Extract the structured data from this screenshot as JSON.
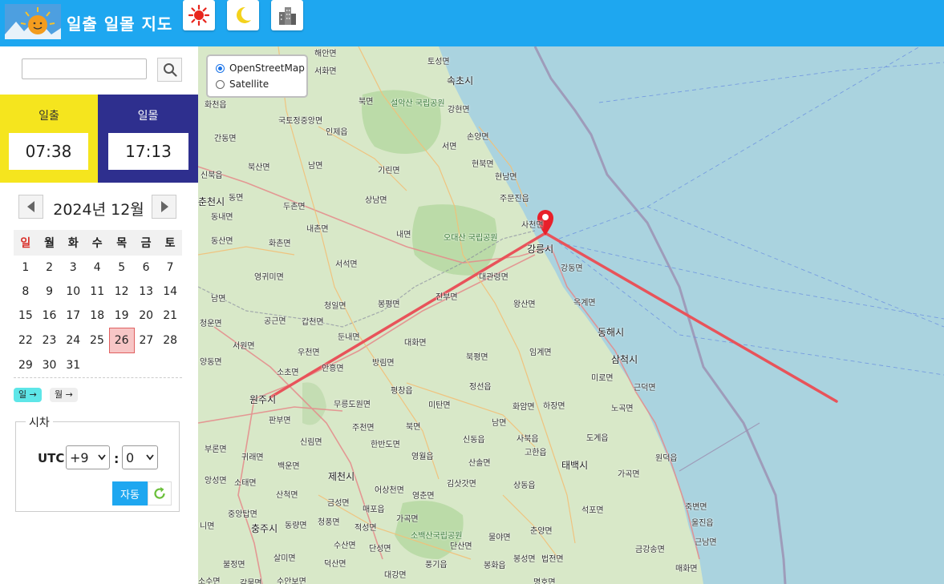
{
  "header": {
    "title": "일출 일몰 지도",
    "buttons": [
      {
        "name": "sun-mode-button",
        "icon": "sun-icon"
      },
      {
        "name": "moon-mode-button",
        "icon": "moon-icon"
      },
      {
        "name": "building-mode-button",
        "icon": "building-icon"
      }
    ]
  },
  "search": {
    "value": "",
    "placeholder": ""
  },
  "sunrise": {
    "label": "일출",
    "time": "07:38"
  },
  "sunset": {
    "label": "일몰",
    "time": "17:13"
  },
  "calendar": {
    "month_label": "2024년 12월",
    "weekdays": [
      "일",
      "월",
      "화",
      "수",
      "목",
      "금",
      "토"
    ],
    "weeks": [
      [
        "1",
        "2",
        "3",
        "4",
        "5",
        "6",
        "7"
      ],
      [
        "8",
        "9",
        "10",
        "11",
        "12",
        "13",
        "14"
      ],
      [
        "15",
        "16",
        "17",
        "18",
        "19",
        "20",
        "21"
      ],
      [
        "22",
        "23",
        "24",
        "25",
        "26",
        "27",
        "28"
      ],
      [
        "29",
        "30",
        "31",
        "",
        "",
        "",
        ""
      ]
    ],
    "selected_day": "26",
    "next_day_label": "일 →",
    "next_month_label": "월 →"
  },
  "timezone": {
    "legend": "시차",
    "label": "UTC",
    "hours": "+9",
    "separator": ":",
    "minutes": "0",
    "auto_label": "자동"
  },
  "map": {
    "layers": [
      {
        "label": "OpenStreetMap",
        "selected": true
      },
      {
        "label": "Satellite",
        "selected": false
      }
    ],
    "labels": [
      {
        "text": "해안면"
      },
      {
        "text": "토성면"
      },
      {
        "text": "서화면"
      },
      {
        "text": "속초시"
      },
      {
        "text": "화천읍"
      },
      {
        "text": "북면"
      },
      {
        "text": "설악산 국립공원"
      },
      {
        "text": "강현면"
      },
      {
        "text": "국토정중앙면"
      },
      {
        "text": "인제읍"
      },
      {
        "text": "손양면"
      },
      {
        "text": "간동면"
      },
      {
        "text": "서면"
      },
      {
        "text": "북산면"
      },
      {
        "text": "남면"
      },
      {
        "text": "현북면"
      },
      {
        "text": "신북읍"
      },
      {
        "text": "기린면"
      },
      {
        "text": "현남면"
      },
      {
        "text": "동면"
      },
      {
        "text": "상남면"
      },
      {
        "text": "주문진읍"
      },
      {
        "text": "춘천시"
      },
      {
        "text": "두촌면"
      },
      {
        "text": "동내면"
      },
      {
        "text": "내면"
      },
      {
        "text": "사천면"
      },
      {
        "text": "내촌면"
      },
      {
        "text": "동산면"
      },
      {
        "text": "화촌면"
      },
      {
        "text": "오대산 국립공원"
      },
      {
        "text": "강릉시"
      },
      {
        "text": "서석면"
      },
      {
        "text": "강동면"
      },
      {
        "text": "영귀미면"
      },
      {
        "text": "대관령면"
      },
      {
        "text": "남면"
      },
      {
        "text": "진부면"
      },
      {
        "text": "왕산면"
      },
      {
        "text": "옥계면"
      },
      {
        "text": "청일면"
      },
      {
        "text": "봉평면"
      },
      {
        "text": "청운면"
      },
      {
        "text": "공근면"
      },
      {
        "text": "갑천면"
      },
      {
        "text": "둔내면"
      },
      {
        "text": "동해시"
      },
      {
        "text": "서원면"
      },
      {
        "text": "우천면"
      },
      {
        "text": "대화면"
      },
      {
        "text": "임계면"
      },
      {
        "text": "삼척시"
      },
      {
        "text": "양동면"
      },
      {
        "text": "안흥면"
      },
      {
        "text": "방림면"
      },
      {
        "text": "북평면"
      },
      {
        "text": "소초면"
      },
      {
        "text": "미로면"
      },
      {
        "text": "평창읍"
      },
      {
        "text": "정선읍"
      },
      {
        "text": "근덕면"
      },
      {
        "text": "원주시"
      },
      {
        "text": "무릉도원면"
      },
      {
        "text": "미탄면"
      },
      {
        "text": "화암면"
      },
      {
        "text": "하장면"
      },
      {
        "text": "노곡면"
      },
      {
        "text": "판부면"
      },
      {
        "text": "주천면"
      },
      {
        "text": "북면"
      },
      {
        "text": "남면"
      },
      {
        "text": "신림면"
      },
      {
        "text": "한반도면"
      },
      {
        "text": "신동읍"
      },
      {
        "text": "사북읍"
      },
      {
        "text": "도계읍"
      },
      {
        "text": "부론면"
      },
      {
        "text": "귀래면"
      },
      {
        "text": "영월읍"
      },
      {
        "text": "고한읍"
      },
      {
        "text": "원덕읍"
      },
      {
        "text": "백운면"
      },
      {
        "text": "산솔면"
      },
      {
        "text": "태백시"
      },
      {
        "text": "앙성면"
      },
      {
        "text": "소태면"
      },
      {
        "text": "제천시"
      },
      {
        "text": "김삿갓면"
      },
      {
        "text": "가곡면"
      },
      {
        "text": "산척면"
      },
      {
        "text": "어상천면"
      },
      {
        "text": "영춘면"
      },
      {
        "text": "상동읍"
      },
      {
        "text": "중앙탑면"
      },
      {
        "text": "금성면"
      },
      {
        "text": "매포읍"
      },
      {
        "text": "석포면"
      },
      {
        "text": "죽변면"
      },
      {
        "text": "충주시"
      },
      {
        "text": "동량면"
      },
      {
        "text": "청풍면"
      },
      {
        "text": "가곡면"
      },
      {
        "text": "춘양면"
      },
      {
        "text": "울진읍"
      },
      {
        "text": "니면"
      },
      {
        "text": "적성면"
      },
      {
        "text": "소백산국립공원"
      },
      {
        "text": "물야면"
      },
      {
        "text": "근남면"
      },
      {
        "text": "수산면"
      },
      {
        "text": "단성면"
      },
      {
        "text": "단산면"
      },
      {
        "text": "금강송면"
      },
      {
        "text": "살미면"
      },
      {
        "text": "덕산면"
      },
      {
        "text": "봉성면"
      },
      {
        "text": "법전면"
      },
      {
        "text": "불정면"
      },
      {
        "text": "풍기읍"
      },
      {
        "text": "봉화읍"
      },
      {
        "text": "매화면"
      },
      {
        "text": "소수면"
      },
      {
        "text": "감물면"
      },
      {
        "text": "수안보면"
      },
      {
        "text": "대강면"
      },
      {
        "text": "명호면"
      }
    ]
  },
  "colors": {
    "header": "#1ea7f0",
    "sunrise_panel": "#f5e51e",
    "sunset_panel": "#2e2f8e",
    "sun_line": "#e8535a",
    "marker": "#e8202a",
    "sea": "#aad3df",
    "selected_day": "#f7c6c6"
  }
}
